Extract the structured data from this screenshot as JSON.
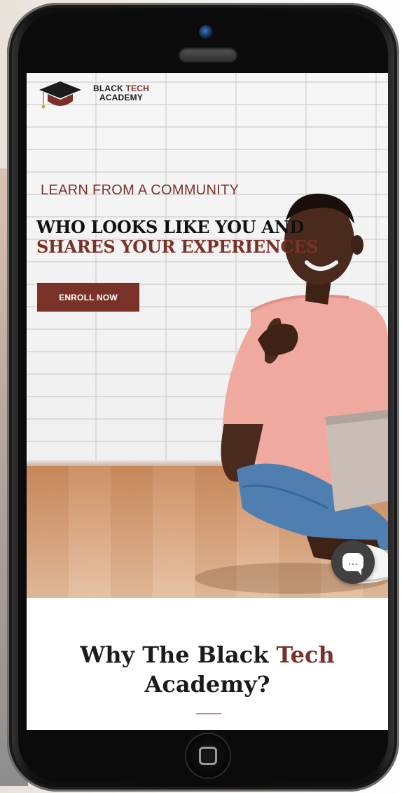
{
  "logo": {
    "line1_a": "BLACK ",
    "line1_b": "TECH",
    "line2": "ACADEMY",
    "icon": "graduation-cap-icon"
  },
  "hero": {
    "tagline": "LEARN FROM A COMMUNITY",
    "headline_line1": "WHO LOOKS LIKE YOU AND",
    "headline_line2": "SHARES YOUR EXPERIENCES",
    "cta_label": "ENROLL NOW"
  },
  "chat": {
    "icon": "chat-bubble-icon",
    "glyph": "…"
  },
  "section": {
    "title_part1": "Why The Black ",
    "title_accent": "Tech",
    "title_part2": "Academy?"
  },
  "colors": {
    "accent": "#7a3228",
    "text": "#1b1b1b",
    "chat_bg": "#404040",
    "divider": "#c98b85"
  }
}
